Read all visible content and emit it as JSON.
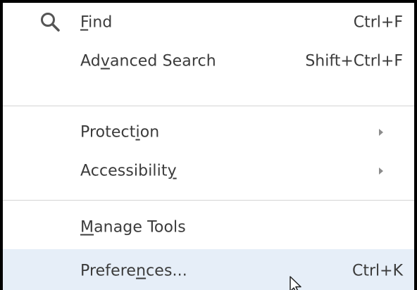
{
  "menu": {
    "items": [
      {
        "label_pre": "",
        "label_u": "F",
        "label_post": "ind",
        "shortcut": "Ctrl+F",
        "icon": "search-icon"
      },
      {
        "label_pre": "Ad",
        "label_u": "v",
        "label_post": "anced Search",
        "shortcut": "Shift+Ctrl+F"
      },
      {
        "label_pre": "Protect",
        "label_u": "i",
        "label_post": "on",
        "submenu": true
      },
      {
        "label_pre": "Accessibilit",
        "label_u": "y",
        "label_post": "",
        "submenu": true
      },
      {
        "label_pre": "",
        "label_u": "M",
        "label_post": "anage Tools"
      },
      {
        "label_pre": "Prefere",
        "label_u": "n",
        "label_post": "ces...",
        "shortcut": "Ctrl+K",
        "highlighted": true
      }
    ]
  },
  "colors": {
    "highlight": "#e6eef8",
    "text": "#3b3b3b",
    "separator": "#d4d4d4",
    "border": "#000000"
  }
}
